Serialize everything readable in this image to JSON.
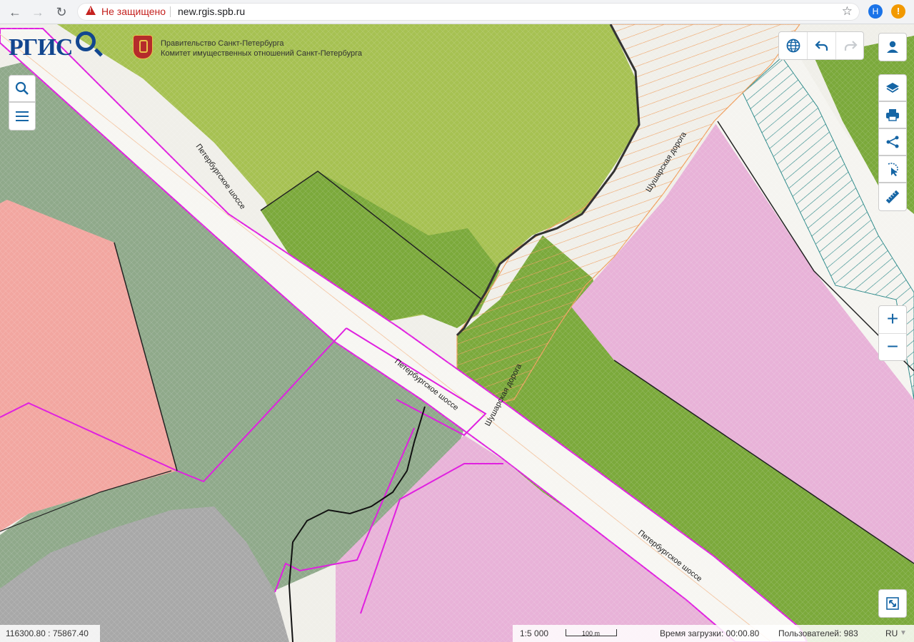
{
  "browser": {
    "back_icon": "arrow-left-icon",
    "forward_icon": "arrow-right-icon",
    "reload_icon": "reload-icon",
    "security_label": "Не защищено",
    "url": "new.rgis.spb.ru",
    "profile_initial": "Н",
    "alert_badge": "!"
  },
  "header": {
    "logo_text": "РГИС",
    "gov_line1": "Правительство Санкт-Петербурга",
    "gov_line2": "Комитет имущественных отношений Санкт-Петербурга"
  },
  "map": {
    "road_labels": [
      "Петербургское шоссе",
      "Петербургское шоссе",
      "Петербургское шоссе",
      "Шушарская дорога",
      "Шушарская дорога"
    ],
    "colors": {
      "pink_zone": "#e8b2d8",
      "salmon_zone": "#f2a6a0",
      "dark_green_zone": "#8fa98a",
      "olive_zone": "#a6c152",
      "green_zone": "#7ba93b",
      "gray_zone": "#a8a8a8",
      "magenta_border": "#e020e0",
      "orange_hatch": "#f0a060",
      "teal_hatch": "#2d8a8a"
    }
  },
  "toolbar": {
    "globe_icon": "globe-icon",
    "undo_icon": "undo-icon",
    "redo_icon": "redo-icon",
    "user_icon": "user-icon",
    "search_icon": "search-icon",
    "menu_icon": "menu-icon",
    "layers_icon": "layers-icon",
    "print_icon": "print-icon",
    "share_icon": "share-icon",
    "select_icon": "select-area-icon",
    "measure_icon": "ruler-icon",
    "zoom_in": "+",
    "zoom_out": "−",
    "fullscreen_icon": "fullscreen-icon"
  },
  "status": {
    "coordinates": "116300.80 : 75867.40",
    "scale": "1:5 000",
    "scale_bar_label": "100 m",
    "load_time": "Время загрузки: 00:00.80",
    "users": "Пользователей: 983",
    "language": "RU"
  }
}
